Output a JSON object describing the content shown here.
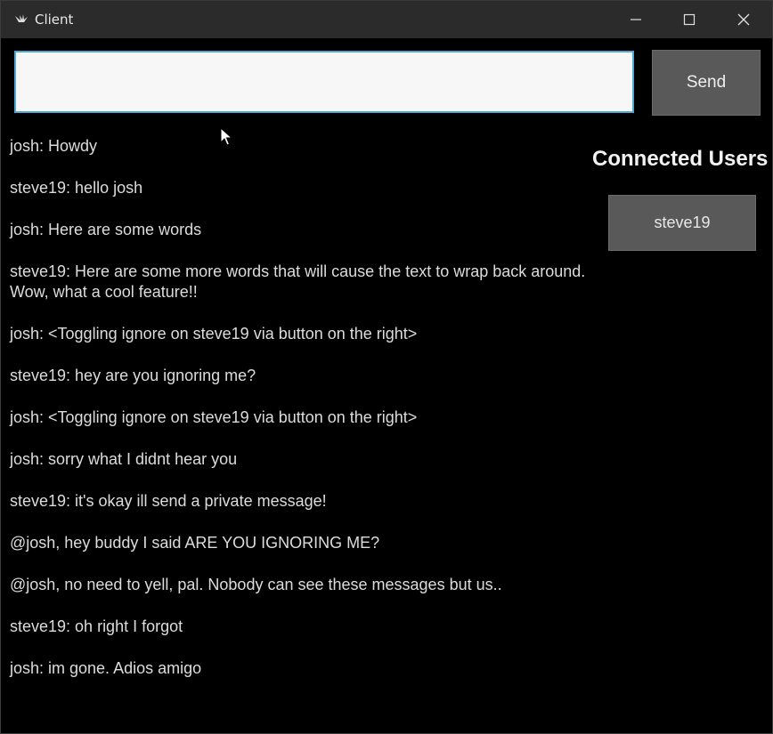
{
  "window": {
    "title": "Client",
    "icon": "kivy-app-icon"
  },
  "controls": {
    "minimize_icon": "minimize-icon",
    "maximize_icon": "maximize-icon",
    "close_icon": "close-icon"
  },
  "input": {
    "value": "",
    "placeholder": ""
  },
  "send": {
    "label": "Send"
  },
  "messages": [
    "josh: Howdy",
    "steve19: hello josh",
    "josh: Here are some words",
    "steve19: Here are some more words that will cause the text to wrap back around. Wow, what a cool feature!!",
    "josh: <Toggling ignore on steve19 via button on the right>",
    "steve19: hey are you ignoring me?",
    "josh: <Toggling ignore on steve19 via button on the right>",
    "josh: sorry what I didnt hear you",
    "steve19: it's okay ill send a private message!",
    "@josh, hey buddy I said ARE YOU IGNORING ME?",
    "@josh,  no need to yell, pal. Nobody can see these messages but us..",
    "steve19: oh right I forgot",
    "josh: im gone. Adios amigo"
  ],
  "users": {
    "title": "Connected Users",
    "list": [
      "steve19"
    ]
  },
  "colors": {
    "input_border": "#4fa8d6",
    "button_bg": "#595959",
    "background": "#000000"
  }
}
